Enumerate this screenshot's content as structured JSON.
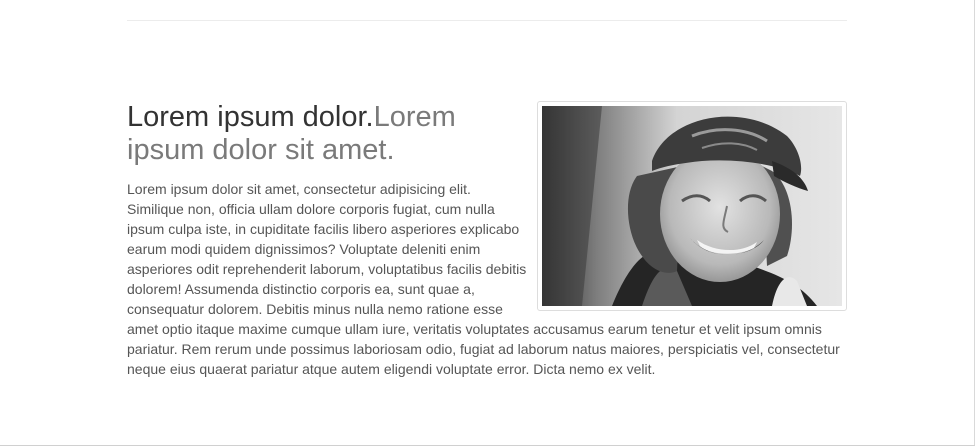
{
  "feature": {
    "heading_main": "Lorem ipsum dolor.",
    "heading_muted": "Lorem ipsum dolor sit amet.",
    "body": "Lorem ipsum dolor sit amet, consectetur adipisicing elit. Similique non, officia ullam dolore corporis fugiat, cum nulla ipsum culpa iste, in cupiditate facilis libero asperiores explicabo earum modi quidem dignissimos? Voluptate deleniti enim asperiores odit reprehenderit laborum, voluptatibus facilis debitis dolorem! Assumenda distinctio corporis ea, sunt quae a, consequatur dolorem. Debitis minus nulla nemo ratione esse amet optio itaque maxime cumque ullam iure, veritatis voluptates accusamus earum tenetur et velit ipsum omnis pariatur. Rem rerum unde possimus laboriosam odio, fugiat ad laborum natus maiores, perspiciatis vel, consectetur neque eius quaerat pariatur atque autem eligendi voluptate error. Dicta nemo ex velit.",
    "photo": {
      "subject": "black-and-white portrait of a smiling woman wearing a baseball cap"
    }
  }
}
